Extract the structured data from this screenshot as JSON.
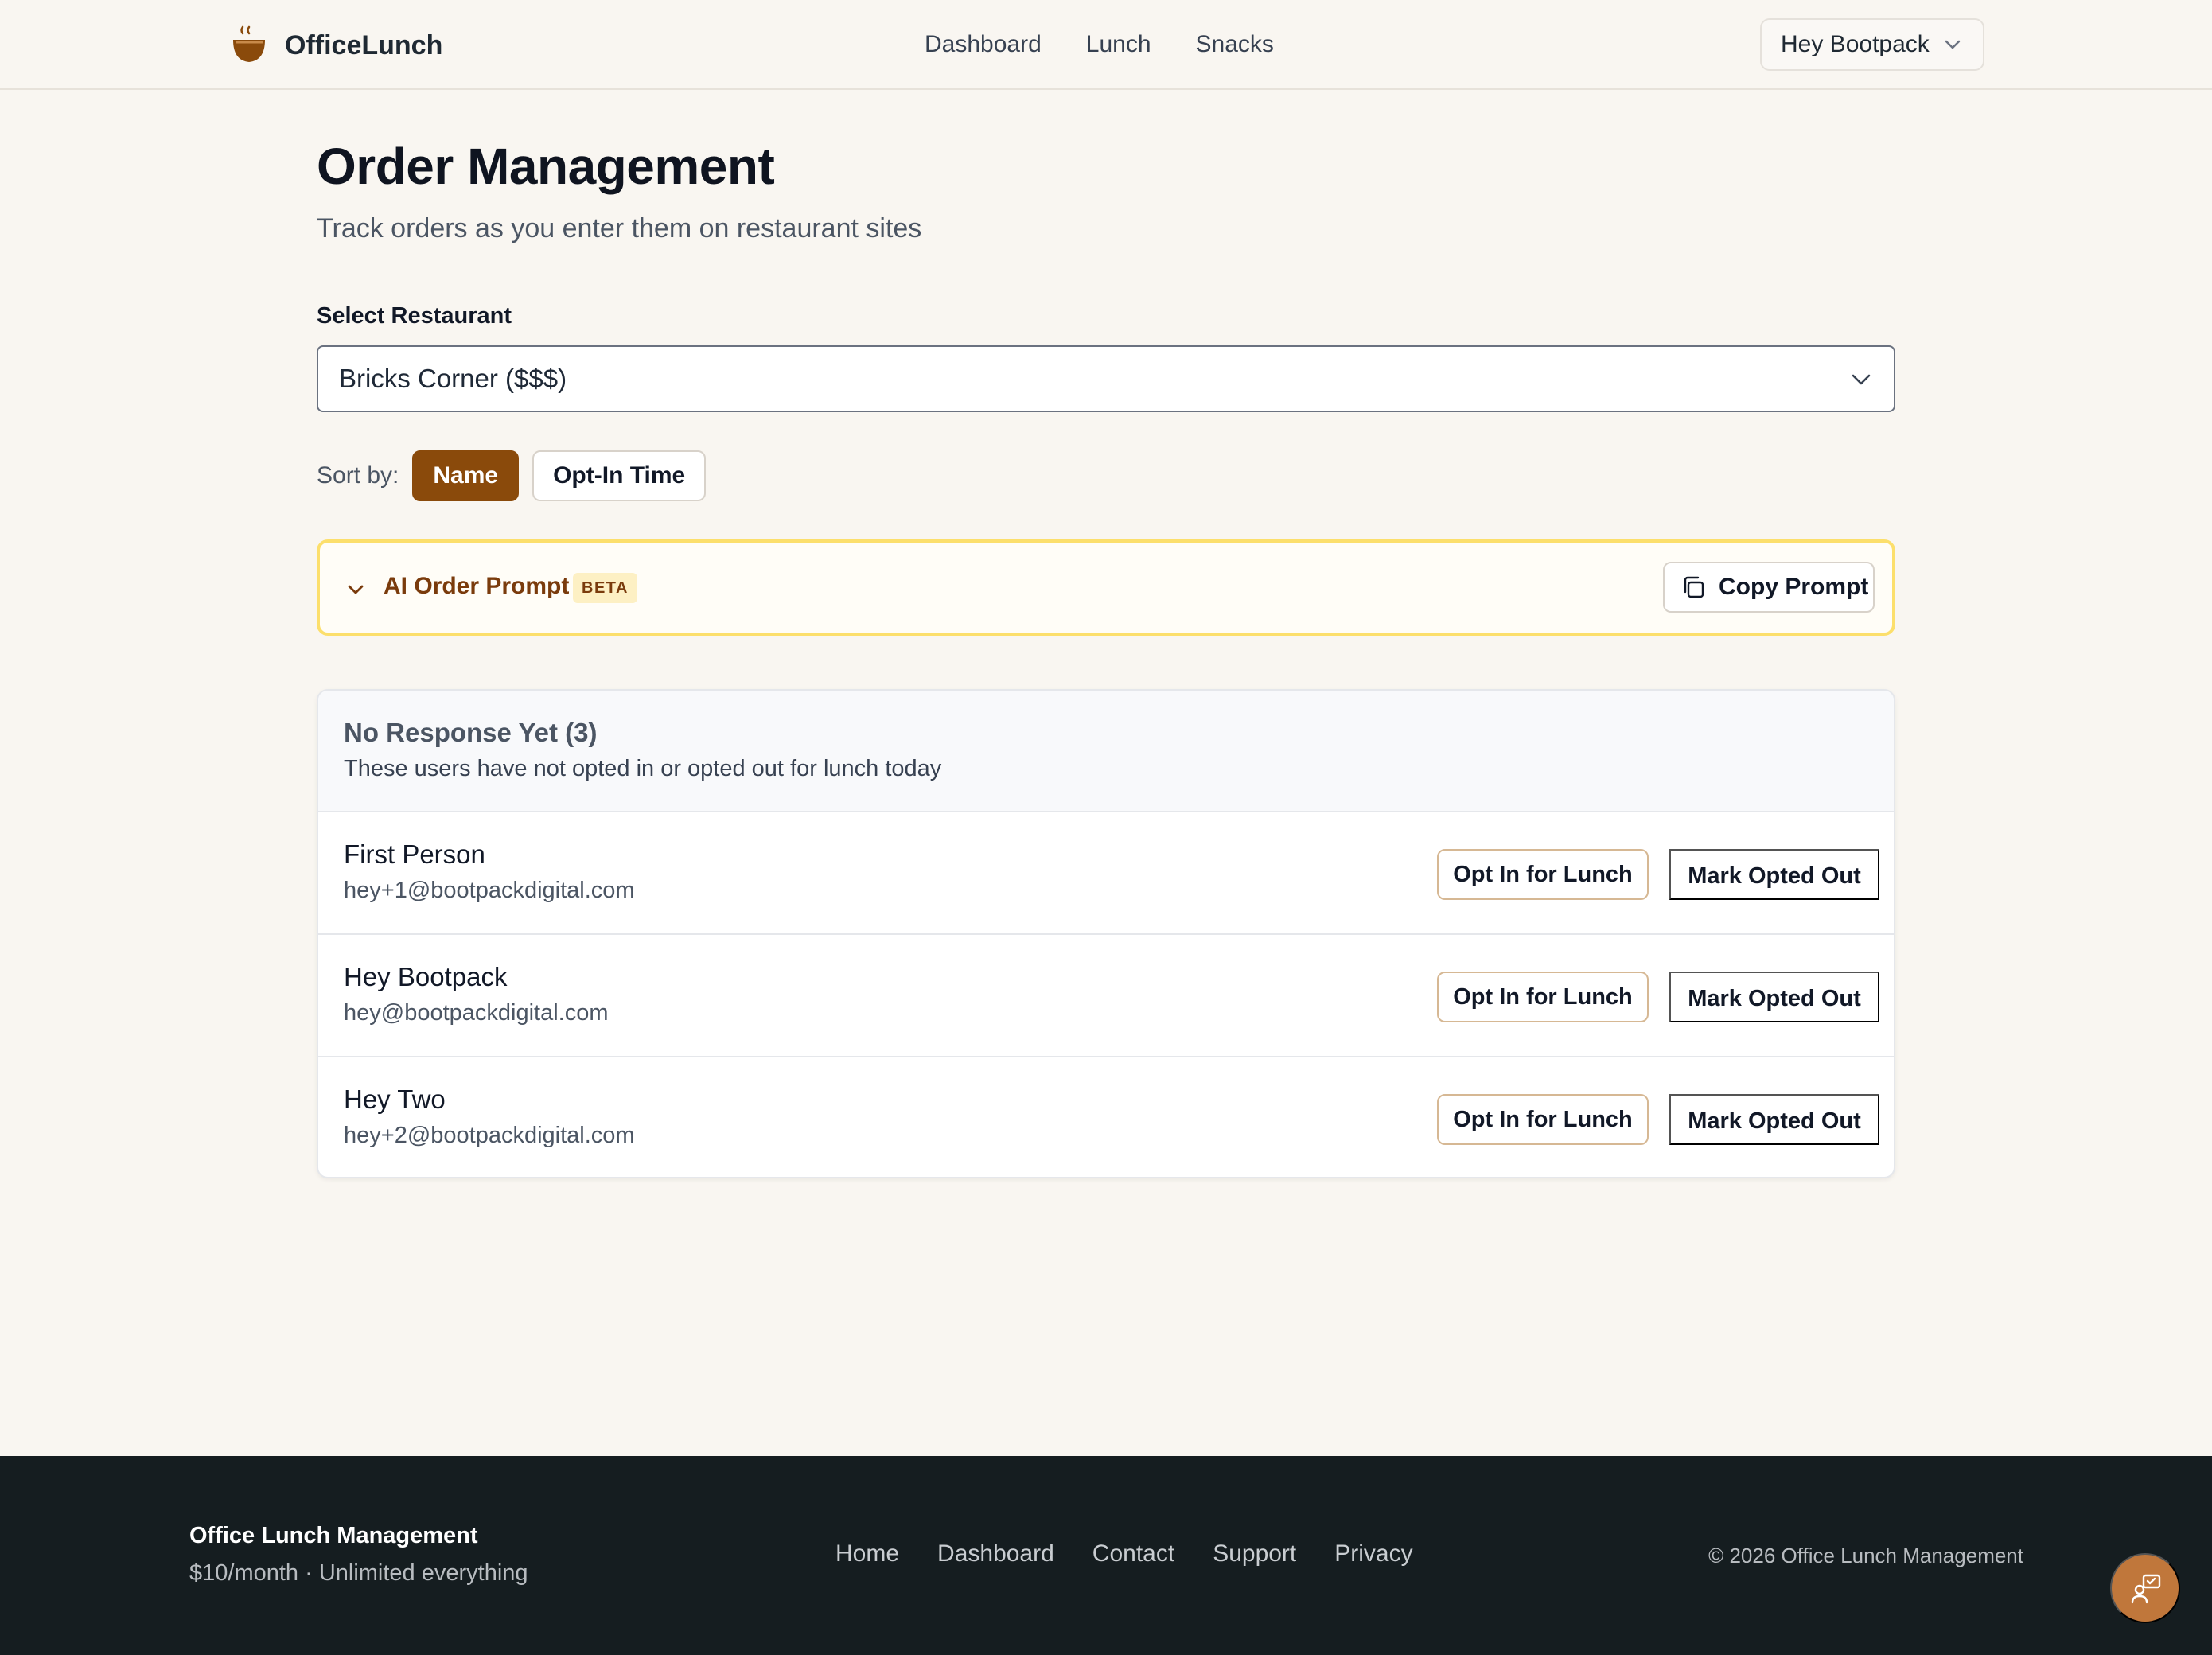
{
  "colors": {
    "page_bg": "#f9f6f1",
    "accent": "#8a4a0b",
    "ai_border": "#fcdf6c",
    "footer_bg": "#151d20",
    "chat_button": "#c0773b"
  },
  "header": {
    "brand_icon": "coffee-bowl-icon",
    "brand_name": "OfficeLunch",
    "nav": [
      {
        "label": "Dashboard"
      },
      {
        "label": "Lunch"
      },
      {
        "label": "Snacks"
      }
    ],
    "user_menu_label": "Hey Bootpack",
    "user_menu_icon": "chevron-down-icon"
  },
  "main": {
    "title": "Order Management",
    "subtitle": "Track orders as you enter them on restaurant sites",
    "restaurant_select": {
      "label": "Select Restaurant",
      "value": "Bricks Corner ($$$)"
    },
    "sort": {
      "label": "Sort by:",
      "options": [
        {
          "label": "Name",
          "active": true
        },
        {
          "label": "Opt-In Time",
          "active": false
        }
      ]
    },
    "ai_prompt": {
      "title": "AI Order Prompt",
      "badge": "BETA",
      "copy_label": "Copy Prompt",
      "copy_icon": "copy-icon"
    },
    "no_response": {
      "title": "No Response Yet (3)",
      "description": "These users have not opted in or opted out for lunch today",
      "opt_in_label": "Opt In for Lunch",
      "opt_out_label": "Mark Opted Out",
      "users": [
        {
          "name": "First Person",
          "email": "hey+1@bootpackdigital.com"
        },
        {
          "name": "Hey Bootpack",
          "email": "hey@bootpackdigital.com"
        },
        {
          "name": "Hey Two",
          "email": "hey+2@bootpackdigital.com"
        }
      ]
    }
  },
  "footer": {
    "title": "Office Lunch Management",
    "tagline": "$10/month · Unlimited everything",
    "links": [
      {
        "label": "Home"
      },
      {
        "label": "Dashboard"
      },
      {
        "label": "Contact"
      },
      {
        "label": "Support"
      },
      {
        "label": "Privacy"
      }
    ],
    "copyright": "© 2026 Office Lunch Management",
    "chat_icon": "feedback-chat-icon"
  }
}
